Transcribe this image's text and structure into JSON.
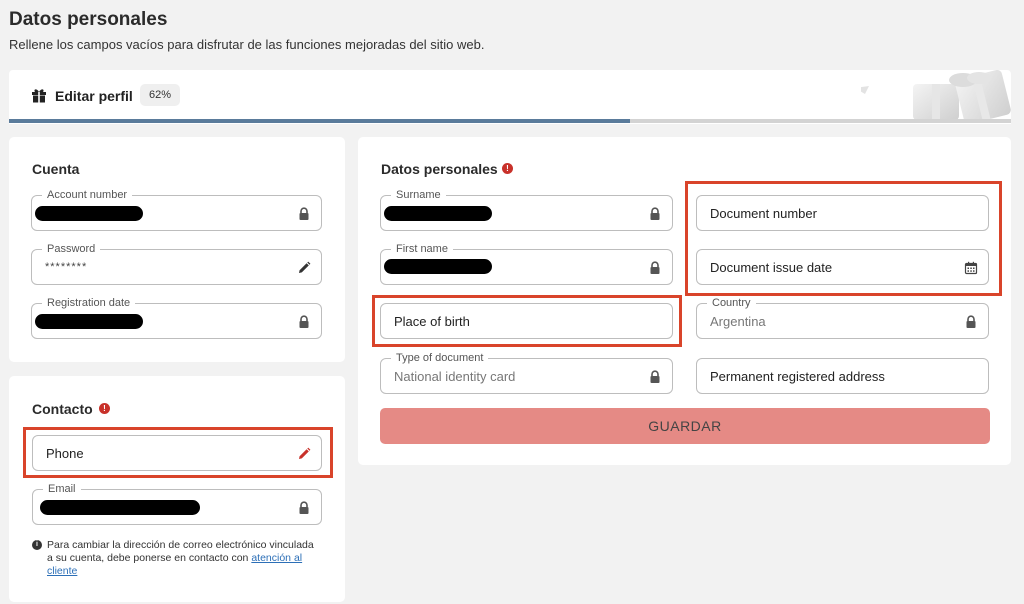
{
  "page": {
    "title": "Datos personales",
    "subtitle": "Rellene los campos vacíos para disfrutar de las funciones mejoradas del sitio web."
  },
  "profile_banner": {
    "title": "Editar perfil",
    "percent_label": "62%",
    "progress": 0.62,
    "icon": "gift-icon"
  },
  "account": {
    "title": "Cuenta",
    "account_number": {
      "label": "Account number",
      "icon": "lock-icon"
    },
    "password": {
      "label": "Password",
      "value": "********",
      "icon": "pencil-icon"
    },
    "registration_date": {
      "label": "Registration date",
      "icon": "lock-icon"
    }
  },
  "contact": {
    "title": "Contacto",
    "alert_mark": "!",
    "phone": {
      "placeholder": "Phone",
      "icon": "pencil-icon"
    },
    "email": {
      "label": "Email",
      "icon": "lock-icon"
    },
    "note_mark": "i",
    "note": "Para cambiar la dirección de correo electrónico vinculada a su cuenta, debe ponerse en contacto con ",
    "note_link": "atención al cliente"
  },
  "personal": {
    "title": "Datos personales",
    "alert_mark": "!",
    "surname": {
      "label": "Surname",
      "icon": "lock-icon"
    },
    "first_name": {
      "label": "First name",
      "icon": "lock-icon"
    },
    "place_of_birth": {
      "placeholder": "Place of birth"
    },
    "type_of_document": {
      "label": "Type of document",
      "value": "National identity card",
      "icon": "lock-icon"
    },
    "document_number": {
      "placeholder": "Document number"
    },
    "document_issue_date": {
      "placeholder": "Document issue date",
      "icon": "calendar-icon"
    },
    "country": {
      "label": "Country",
      "value": "Argentina",
      "icon": "lock-icon"
    },
    "permanent_address": {
      "placeholder": "Permanent registered address"
    },
    "save_label": "GUARDAR"
  },
  "colors": {
    "highlight": "#d9442a",
    "save_button": "#e58a85",
    "progress_fill": "#5a7b9b",
    "alert": "#c8312a",
    "link": "#2c6fb7"
  }
}
